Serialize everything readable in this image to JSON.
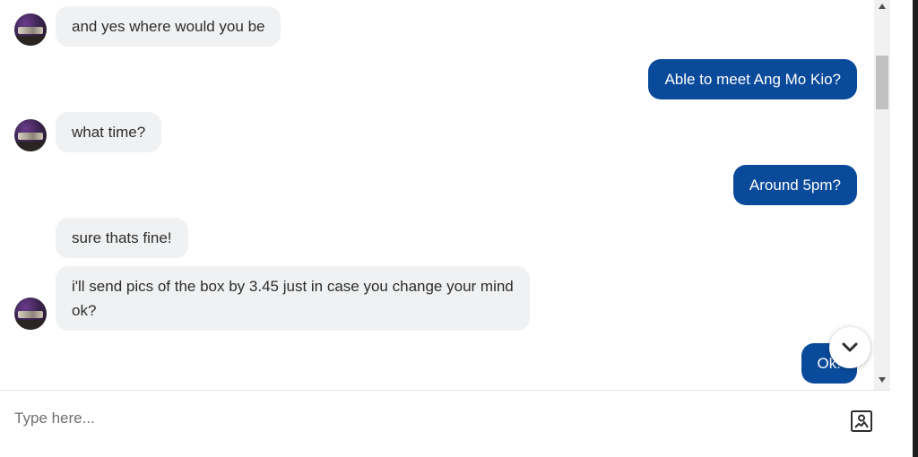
{
  "messages": [
    {
      "direction": "in",
      "text": "and yes where would you be",
      "avatar": true
    },
    {
      "direction": "out",
      "text": "Able to meet Ang Mo Kio?"
    },
    {
      "direction": "in",
      "text": "what time?",
      "avatar": true
    },
    {
      "direction": "out",
      "text": "Around 5pm?"
    },
    {
      "direction": "in",
      "text": "sure thats fine!",
      "avatar": false
    },
    {
      "direction": "in",
      "line1": "i'll send pics of the box by 3.45 just in case you change your mind",
      "line2": "ok?",
      "avatar": true
    },
    {
      "direction": "out",
      "text": "Ok!"
    }
  ],
  "composer": {
    "placeholder": "Type here...",
    "value": ""
  },
  "icons": {
    "jump": "chevron-down-icon",
    "attach": "image-icon",
    "scroll_up": "triangle-up-icon",
    "scroll_down": "triangle-down-icon"
  },
  "colors": {
    "outgoing_bubble": "#0a4a9b",
    "incoming_bubble": "#f0f1f2"
  }
}
